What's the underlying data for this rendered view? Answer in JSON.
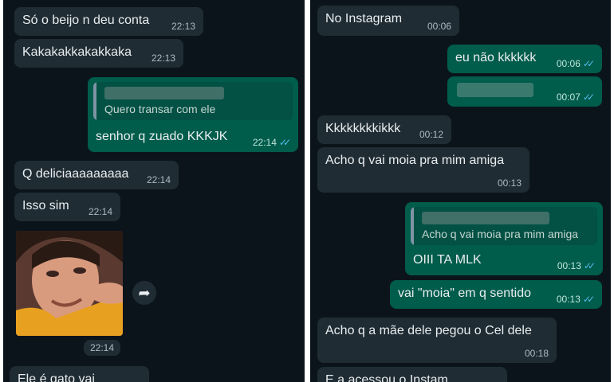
{
  "left": {
    "messages": [
      {
        "text": "Só o beijo n deu conta",
        "time": "22:13"
      },
      {
        "text": "Kakakakkakakkaka",
        "time": "22:13"
      },
      {
        "quote_text": "Quero transar com ele",
        "text": "senhor q zuado KKKJK",
        "time": "22:14"
      },
      {
        "text": "Q deliciaaaaaaaaa",
        "time": "22:14"
      },
      {
        "text": "Isso sim",
        "time": "22:14"
      },
      {
        "time": "22:14"
      },
      {
        "text": "Ele é gato vai"
      }
    ]
  },
  "right": {
    "messages": [
      {
        "text": "No Instagram",
        "time": "00:06"
      },
      {
        "text": "eu não kkkkkk",
        "time": "00:06"
      },
      {
        "time": "00:07"
      },
      {
        "text": "Kkkkkkkkikkk",
        "time": "00:12"
      },
      {
        "text": "Acho q vai moia pra mim amiga",
        "time": "00:13"
      },
      {
        "quote_text": "Acho q vai moia pra mim amiga",
        "text": "OIII TA MLK",
        "time": "00:13"
      },
      {
        "text": "vai \"moia\" em q sentido",
        "time": "00:13"
      },
      {
        "text": "Acho q a mãe dele pegou o Cel dele",
        "time": "00:18"
      },
      {
        "text": "E a acessou o Instam"
      }
    ]
  },
  "colors": {
    "chat_background": "#0b141a",
    "incoming_bubble": "#1f2c34",
    "outgoing_bubble": "#005c4b",
    "read_ticks": "#53bdeb"
  },
  "icons": {
    "forward": "forward-arrow-icon",
    "read_receipt": "double-check-icon"
  }
}
